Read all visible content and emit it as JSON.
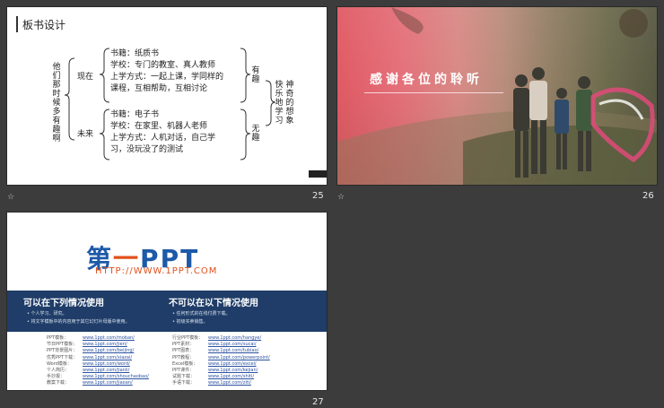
{
  "slides": [
    {
      "number": "25",
      "title": "板书设计",
      "left_vertical": "他们那时候多有趣啊",
      "branch_top": "现在",
      "branch_bottom": "未来",
      "top_block": [
        "书籍：纸质书",
        "学校：专门的教室、真人教师",
        "上学方式：一起上课，学同样的",
        "课程，互相帮助，互相讨论"
      ],
      "bottom_block": [
        "书籍：电子书",
        "学校：在家里、机器人老师",
        "上学方式：人机对话，自己学",
        "习，没玩没了的测试"
      ],
      "right_top": "有趣",
      "right_bottom": "无趣",
      "right_outer1": "快乐地学习",
      "right_outer2": "神奇的想象"
    },
    {
      "number": "26",
      "banner_text": "感谢各位的聆听"
    },
    {
      "number": "27",
      "logo_main": "第一PPT",
      "logo_url": "HTTP://WWW.1PPT.COM",
      "can_title": "可以在下列情况使用",
      "cannot_title": "不可以在以下情况使用",
      "can_notes": [
        "个人学习、研究。",
        "将文字模板中的内容用于其它幻灯片母版中使用。"
      ],
      "cannot_notes": [
        "任何形式的在线付费下载。",
        "初级买卖销售。"
      ],
      "left_links": [
        {
          "label": "PPT模板：",
          "url": "www.1ppt.com/moban/"
        },
        {
          "label": "节日PPT模板：",
          "url": "www.1ppt.com/jieri/"
        },
        {
          "label": "PPT背景图片：",
          "url": "www.1ppt.com/beijing/"
        },
        {
          "label": "优秀PPT下载：",
          "url": "www.1ppt.com/xiazai/"
        },
        {
          "label": "Word模板：",
          "url": "www.1ppt.com/word/"
        },
        {
          "label": "个人简历：",
          "url": "www.1ppt.com/jianli/"
        },
        {
          "label": "手抄报：",
          "url": "www.1ppt.com/shouchaobao/"
        },
        {
          "label": "教案下载：",
          "url": "www.1ppt.com/jiaoan/"
        }
      ],
      "right_links": [
        {
          "label": "行业PPT模板：",
          "url": "www.1ppt.com/hangye/"
        },
        {
          "label": "PPT素材：",
          "url": "www.1ppt.com/sucai/"
        },
        {
          "label": "PPT图表：",
          "url": "www.1ppt.com/tubiao/"
        },
        {
          "label": "PPT教程：",
          "url": "www.1ppt.com/powerpoint/"
        },
        {
          "label": "Excel模板：",
          "url": "www.1ppt.com/excel/"
        },
        {
          "label": "PPT课件：",
          "url": "www.1ppt.com/kejian/"
        },
        {
          "label": "试题下载：",
          "url": "www.1ppt.com/shiti/"
        },
        {
          "label": "手语下载：",
          "url": "www.1ppt.com/ziti/"
        }
      ]
    }
  ],
  "colors": {
    "workspace": "#3c3c3c",
    "logo_blue": "#1d5aa8",
    "logo_orange": "#e1501b",
    "band_blue": "#1f3d68"
  }
}
